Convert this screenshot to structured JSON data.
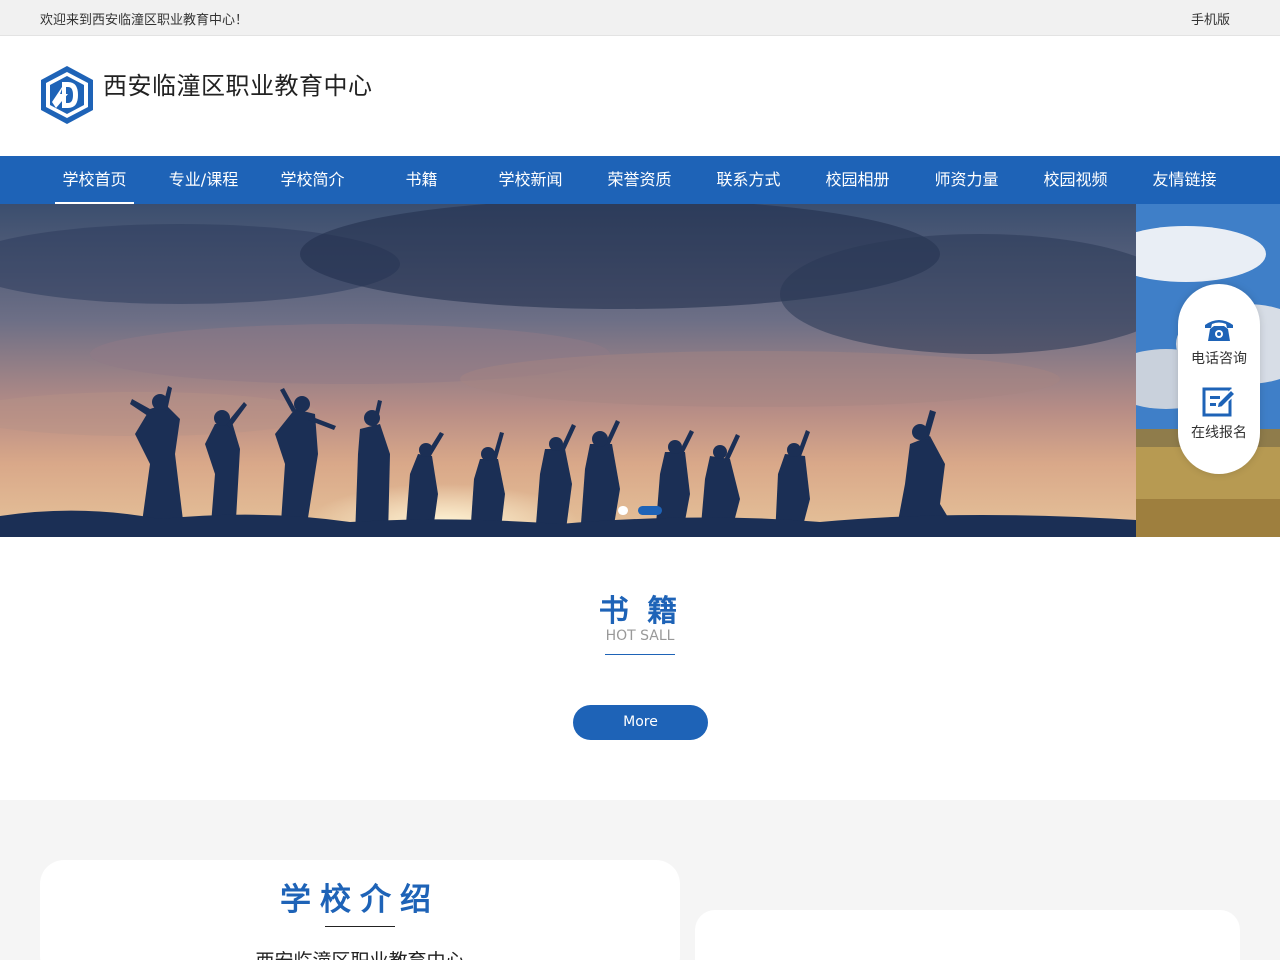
{
  "topbar": {
    "welcome": "欢迎来到西安临潼区职业教育中心！",
    "mobile": "手机版"
  },
  "header": {
    "site_name": "西安临潼区职业教育中心"
  },
  "nav": {
    "items": [
      {
        "label": "学校首页",
        "active": true
      },
      {
        "label": "专业/课程"
      },
      {
        "label": "学校简介"
      },
      {
        "label": "书籍"
      },
      {
        "label": "学校新闻"
      },
      {
        "label": "荣誉资质"
      },
      {
        "label": "联系方式"
      },
      {
        "label": "校园相册"
      },
      {
        "label": "师资力量"
      },
      {
        "label": "校园视频"
      },
      {
        "label": "友情链接"
      }
    ]
  },
  "banner": {
    "slide_count": 2,
    "active_slide": 2
  },
  "float_panel": {
    "phone_label": "电话咨询",
    "signup_label": "在线报名",
    "phone_icon": "phone-icon",
    "signup_icon": "edit-icon"
  },
  "books": {
    "title": "书 籍",
    "subtitle": "HOT SALL",
    "more": "More"
  },
  "about": {
    "title": "学校介绍",
    "name": "西安临潼区职业教育中心"
  },
  "colors": {
    "primary": "#1e63b7",
    "topbar_bg": "#f1f1f1",
    "section_bg": "#f5f5f5"
  }
}
